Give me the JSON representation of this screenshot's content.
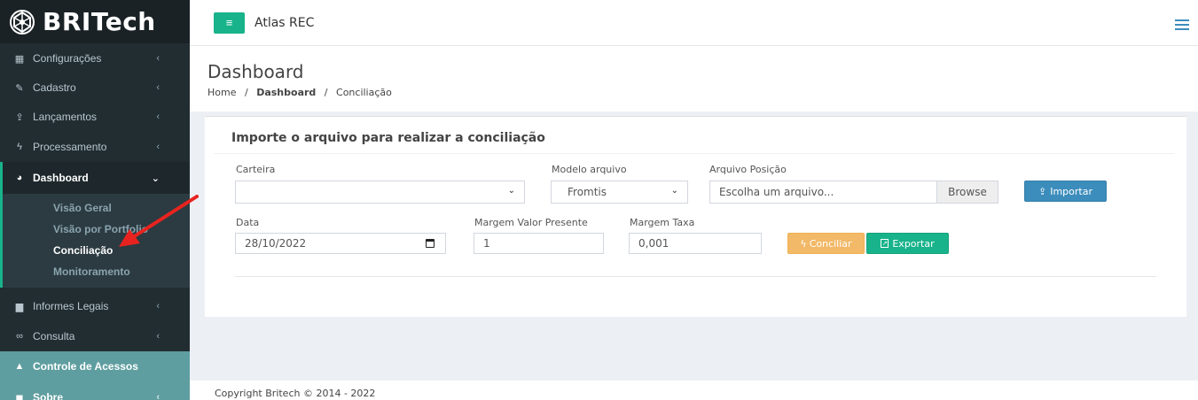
{
  "sidebar": {
    "brand": "BRITech",
    "items": [
      {
        "label": "Configurações",
        "icon": "grid-icon"
      },
      {
        "label": "Cadastro",
        "icon": "edit-icon"
      },
      {
        "label": "Lançamentos",
        "icon": "upload-icon"
      },
      {
        "label": "Processamento",
        "icon": "bolt-icon"
      },
      {
        "label": "Dashboard",
        "icon": "pie-chart-icon"
      },
      {
        "label": "Informes Legais",
        "icon": "building-icon"
      },
      {
        "label": "Consulta",
        "icon": "binoculars-icon"
      },
      {
        "label": "Controle de Acessos",
        "icon": "lock-icon"
      },
      {
        "label": "Sobre",
        "icon": "book-icon"
      }
    ],
    "dashboard_sub": [
      {
        "label": "Visão Geral"
      },
      {
        "label": "Visão por Portfolio"
      },
      {
        "label": "Conciliação"
      },
      {
        "label": "Monitoramento"
      }
    ]
  },
  "topbar": {
    "title": "Atlas REC"
  },
  "header": {
    "title": "Dashboard",
    "breadcrumb": [
      "Home",
      "Dashboard",
      "Conciliação"
    ],
    "sep": "/"
  },
  "form": {
    "title": "Importe o arquivo para realizar a conciliação",
    "carteira_label": "Carteira",
    "carteira_value": "",
    "modelo_label": "Modelo arquivo",
    "modelo_value": "Fromtis",
    "arquivo_label": "Arquivo Posição",
    "arquivo_placeholder": "Escolha um arquivo...",
    "browse_label": "Browse",
    "importar_label": "Importar",
    "data_label": "Data",
    "data_value": "28/10/2022",
    "margem_vp_label": "Margem Valor Presente",
    "margem_vp_value": "1",
    "margem_taxa_label": "Margem Taxa",
    "margem_taxa_value": "0,001",
    "conciliar_label": "Conciliar",
    "exportar_label": "Exportar"
  },
  "footer": {
    "text": "Copyright Britech © 2014 - 2022"
  },
  "colors": {
    "sidebar_bg": "#222d32",
    "accent_green": "#18b38a",
    "primary_blue": "#3c8dbc",
    "warning_orange": "#f0ad4e",
    "annotation_red": "#e8231f"
  }
}
